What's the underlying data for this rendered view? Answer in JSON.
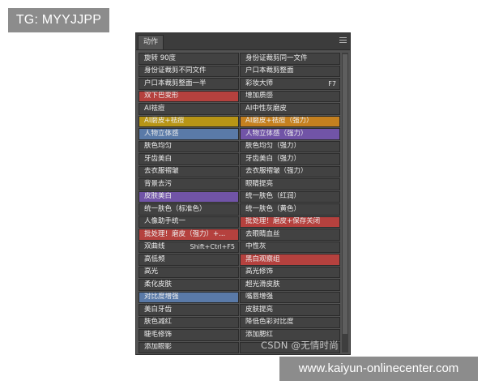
{
  "tag_badge": "TG: MYYJJPP",
  "panel": {
    "title": "动作",
    "menu_icon": "hamburger-menu-icon"
  },
  "colors": {
    "red": "#b5413e",
    "gold": "#b89516",
    "orange": "#c5801f",
    "blue": "#5a7aa8",
    "purple": "#7154a7",
    "default": "#424242"
  },
  "actions": [
    {
      "label": "旋转 90度",
      "shortcut": "",
      "color": "default"
    },
    {
      "label": "身份证裁剪同一文件",
      "shortcut": "",
      "color": "default"
    },
    {
      "label": "身份证裁剪不同文件",
      "shortcut": "",
      "color": "default"
    },
    {
      "label": "户口本裁剪整面",
      "shortcut": "",
      "color": "default"
    },
    {
      "label": "户口本裁剪整面一半",
      "shortcut": "",
      "color": "default"
    },
    {
      "label": "彩妆大师",
      "shortcut": "F7",
      "color": "default"
    },
    {
      "label": "双下巴变形",
      "shortcut": "",
      "color": "red"
    },
    {
      "label": "增加质感",
      "shortcut": "",
      "color": "default"
    },
    {
      "label": "AI祛痘",
      "shortcut": "",
      "color": "default"
    },
    {
      "label": "AI中性灰磨皮",
      "shortcut": "",
      "color": "default"
    },
    {
      "label": "AI磨皮+祛痘",
      "shortcut": "",
      "color": "gold"
    },
    {
      "label": "AI磨皮+祛痘（强力）",
      "shortcut": "",
      "color": "orange"
    },
    {
      "label": "人物立体感",
      "shortcut": "",
      "color": "blue"
    },
    {
      "label": "人物立体感（强力）",
      "shortcut": "",
      "color": "purple"
    },
    {
      "label": "肤色均匀",
      "shortcut": "",
      "color": "default"
    },
    {
      "label": "肤色均匀（强力）",
      "shortcut": "",
      "color": "default"
    },
    {
      "label": "牙齿美白",
      "shortcut": "",
      "color": "default"
    },
    {
      "label": "牙齿美白（强力）",
      "shortcut": "",
      "color": "default"
    },
    {
      "label": "去衣服褶皱",
      "shortcut": "",
      "color": "default"
    },
    {
      "label": "去衣服褶皱（强力）",
      "shortcut": "",
      "color": "default"
    },
    {
      "label": "背景去污",
      "shortcut": "",
      "color": "default"
    },
    {
      "label": "眼睛提亮",
      "shortcut": "",
      "color": "default"
    },
    {
      "label": "皮肤美白",
      "shortcut": "",
      "color": "purple"
    },
    {
      "label": "统一肤色（红润）",
      "shortcut": "",
      "color": "default"
    },
    {
      "label": "统一肤色（标准色）",
      "shortcut": "",
      "color": "default"
    },
    {
      "label": "统一肤色（黄色）",
      "shortcut": "",
      "color": "default"
    },
    {
      "label": "人像助手统一",
      "shortcut": "",
      "color": "default"
    },
    {
      "label": "批处理！磨皮+保存关闭",
      "shortcut": "",
      "color": "red"
    },
    {
      "label": "批处理！磨皮（强力）+...",
      "shortcut": "",
      "color": "red"
    },
    {
      "label": "去眼睛血丝",
      "shortcut": "",
      "color": "default"
    },
    {
      "label": "双曲线",
      "shortcut": "Shift+Ctrl+F5",
      "color": "default"
    },
    {
      "label": "中性灰",
      "shortcut": "",
      "color": "default"
    },
    {
      "label": "高低频",
      "shortcut": "",
      "color": "default"
    },
    {
      "label": "黑白观察组",
      "shortcut": "",
      "color": "red"
    },
    {
      "label": "高光",
      "shortcut": "",
      "color": "default"
    },
    {
      "label": "高光修饰",
      "shortcut": "",
      "color": "default"
    },
    {
      "label": "柔化皮肤",
      "shortcut": "",
      "color": "default"
    },
    {
      "label": "超光滑皮肤",
      "shortcut": "",
      "color": "default"
    },
    {
      "label": "对比度增强",
      "shortcut": "",
      "color": "blue"
    },
    {
      "label": "嘴唇增强",
      "shortcut": "",
      "color": "default"
    },
    {
      "label": "美白牙齿",
      "shortcut": "",
      "color": "default"
    },
    {
      "label": "皮肤提亮",
      "shortcut": "",
      "color": "default"
    },
    {
      "label": "肤色减红",
      "shortcut": "",
      "color": "default"
    },
    {
      "label": "降低色彩对比度",
      "shortcut": "",
      "color": "default"
    },
    {
      "label": "睫毛修饰",
      "shortcut": "",
      "color": "default"
    },
    {
      "label": "添加腮红",
      "shortcut": "",
      "color": "default"
    },
    {
      "label": "添加眼影",
      "shortcut": "",
      "color": "default"
    },
    {
      "label": "",
      "shortcut": "",
      "color": "default"
    }
  ],
  "watermark": "CSDN @无情时尚",
  "url_badge": "www.kaiyun-onlinecenter.com"
}
